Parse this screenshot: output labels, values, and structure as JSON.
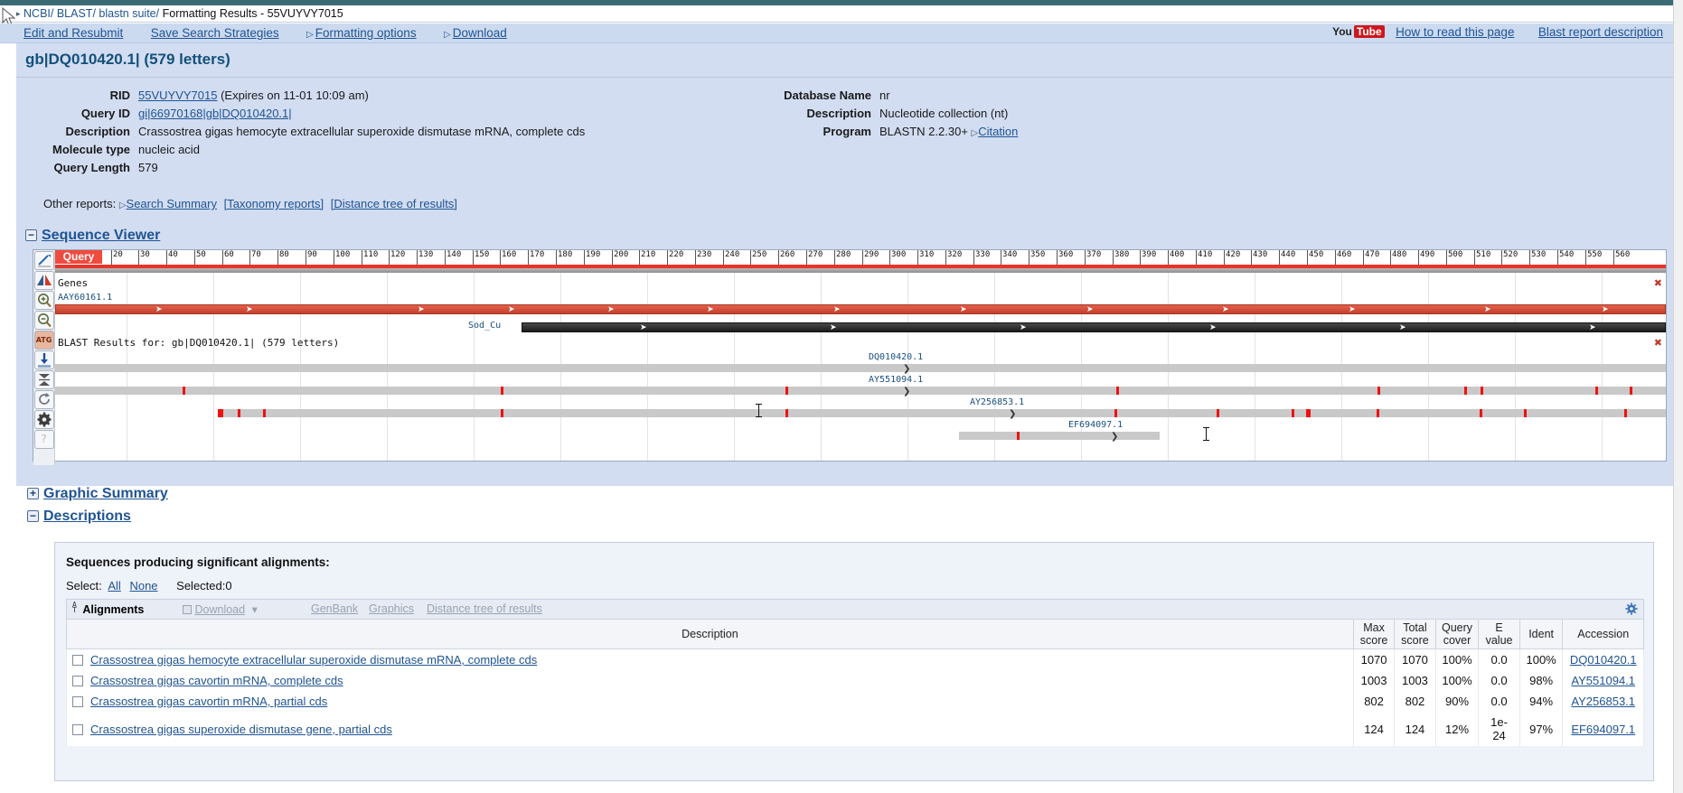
{
  "breadcrumb": {
    "ncbi": "NCBI/",
    "blast": "BLAST/",
    "suite": "blastn suite/",
    "current": "Formatting Results - 55VUYVY7015"
  },
  "nav": {
    "links": [
      {
        "label": "Edit and Resubmit",
        "triangle": false
      },
      {
        "label": "Save Search Strategies",
        "triangle": false
      },
      {
        "label": "Formatting options",
        "triangle": true
      },
      {
        "label": "Download",
        "triangle": true
      }
    ],
    "youtube_you": "You",
    "youtube_tube": "Tube",
    "right_links": [
      {
        "label": "How to read this page"
      },
      {
        "label": "Blast report description"
      }
    ]
  },
  "report": {
    "title": "gb|DQ010420.1| (579 letters)",
    "left_fields": [
      {
        "label": "RID",
        "value": "55VUYVY7015",
        "link": true,
        "suffix": " (Expires on 11-01 10:09 am)"
      },
      {
        "label": "Query ID",
        "value": "gi|66970168|gb|DQ010420.1|",
        "link": true,
        "suffix": ""
      },
      {
        "label": "Description",
        "value": "Crassostrea gigas hemocyte extracellular superoxide dismutase mRNA, complete cds",
        "link": false,
        "suffix": ""
      },
      {
        "label": "Molecule type",
        "value": "nucleic acid",
        "link": false,
        "suffix": ""
      },
      {
        "label": "Query Length",
        "value": "579",
        "link": false,
        "suffix": ""
      }
    ],
    "right_fields": [
      {
        "label": "Database Name",
        "value": "nr",
        "link": false,
        "suffix": ""
      },
      {
        "label": "Description",
        "value": "Nucleotide collection (nt)",
        "link": false,
        "suffix": ""
      },
      {
        "label": "Program",
        "value": "BLASTN 2.2.30+",
        "link": false,
        "suffix": "",
        "extra_link": "Citation"
      }
    ],
    "other_reports_label": "Other reports:",
    "other_reports": [
      {
        "label": "Search Summary",
        "triangle": true
      },
      {
        "label": "[Taxonomy reports]",
        "triangle": false
      },
      {
        "label": "[Distance tree of results]",
        "triangle": false
      }
    ]
  },
  "sections": {
    "sequence_viewer": {
      "toggle": "−",
      "label": "Sequence Viewer"
    },
    "graphic_summary": {
      "toggle": "+",
      "label": "Graphic Summary"
    },
    "descriptions": {
      "toggle": "−",
      "label": "Descriptions"
    }
  },
  "sequence_viewer": {
    "toolbar_icons": [
      "pointer-tool-icon",
      "flip-strands-icon",
      "zoom-in-icon",
      "zoom-out-icon",
      "atg-markers-icon",
      "download-icon",
      "expand-collapse-icon",
      "reload-icon",
      "settings-gear-icon",
      "help-question-icon"
    ],
    "query_badge": "Query",
    "ruler_ticks": [
      20,
      30,
      40,
      50,
      60,
      70,
      80,
      90,
      100,
      110,
      120,
      130,
      140,
      150,
      160,
      170,
      180,
      190,
      200,
      210,
      220,
      230,
      240,
      250,
      260,
      270,
      280,
      290,
      300,
      310,
      320,
      330,
      340,
      350,
      360,
      370,
      380,
      390,
      400,
      410,
      420,
      430,
      440,
      450,
      460,
      470,
      480,
      490,
      500,
      510,
      520,
      530,
      540,
      550,
      560
    ],
    "genes_track_label": "Genes",
    "genes_protein_label": "AAY60161.1",
    "genes_feature_label": "Sod_Cu",
    "blast_track_label": "BLAST Results for: gb|DQ010420.1| (579 letters)",
    "hit_tracks": [
      {
        "accession": "DQ010420.1"
      },
      {
        "accession": "AY551094.1"
      },
      {
        "accession": "AY256853.1"
      },
      {
        "accession": "EF694097.1"
      }
    ],
    "close_glyph": "✖"
  },
  "descriptions": {
    "heading": "Sequences producing significant alignments:",
    "select_label": "Select:",
    "select_all": "All",
    "select_none": "None",
    "selected_count": "Selected:0",
    "toolbar": {
      "alignments": "Alignments",
      "download": "Download",
      "caret": "⌄",
      "genbank": "GenBank",
      "graphics": "Graphics",
      "distance_tree": "Distance tree of results"
    },
    "columns": [
      {
        "line1": "Description",
        "line2": ""
      },
      {
        "line1": "Max",
        "line2": "score"
      },
      {
        "line1": "Total",
        "line2": "score"
      },
      {
        "line1": "Query",
        "line2": "cover"
      },
      {
        "line1": "E",
        "line2": "value"
      },
      {
        "line1": "Ident",
        "line2": ""
      },
      {
        "line1": "Accession",
        "line2": ""
      }
    ],
    "rows": [
      {
        "description": "Crassostrea gigas hemocyte extracellular superoxide dismutase mRNA, complete cds",
        "max_score": "1070",
        "total_score": "1070",
        "query_cover": "100%",
        "e_value": "0.0",
        "ident": "100%",
        "accession": "DQ010420.1"
      },
      {
        "description": "Crassostrea gigas cavortin mRNA, complete cds",
        "max_score": "1003",
        "total_score": "1003",
        "query_cover": "100%",
        "e_value": "0.0",
        "ident": "98%",
        "accession": "AY551094.1"
      },
      {
        "description": "Crassostrea gigas cavortin mRNA, partial cds",
        "max_score": "802",
        "total_score": "802",
        "query_cover": "90%",
        "e_value": "0.0",
        "ident": "94%",
        "accession": "AY256853.1"
      },
      {
        "description": "Crassostrea gigas superoxide dismutase gene, partial cds",
        "max_score": "124",
        "total_score": "124",
        "query_cover": "12%",
        "e_value": "1e-24",
        "ident": "97%",
        "accession": "EF694097.1"
      }
    ]
  },
  "colors": {
    "header_teal": "#3a6b75",
    "panel_blue": "#d2ddf2",
    "link_blue": "#205493",
    "query_red": "#f04b3f",
    "mismatch_red": "#ef1111",
    "youtube_red": "#cc181e"
  }
}
